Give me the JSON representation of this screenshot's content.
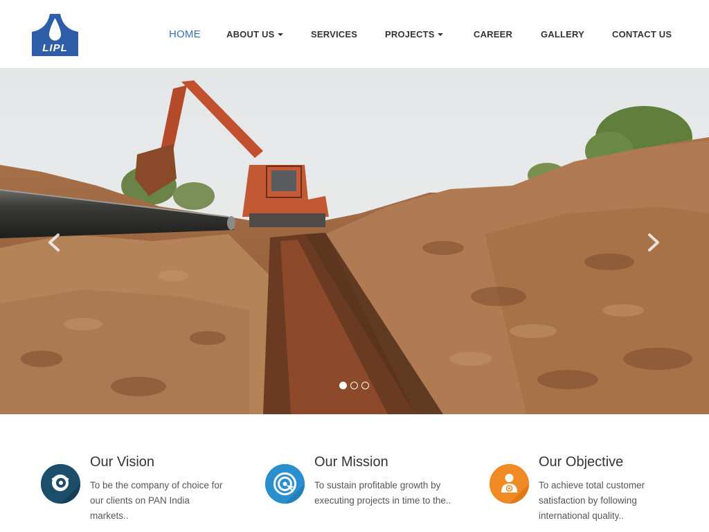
{
  "brand": {
    "logo_text": "LIPL",
    "logo_color": "#2f5ea8"
  },
  "nav": {
    "items": [
      {
        "label": "HOME",
        "active": true
      },
      {
        "label": "ABOUT US",
        "dropdown": true
      },
      {
        "label": "SERVICES"
      },
      {
        "label": "PROJECTS",
        "dropdown": true
      },
      {
        "label": "CAREER"
      },
      {
        "label": "GALLERY"
      },
      {
        "label": "CONTACT US"
      }
    ],
    "active_color": "#3a6db5"
  },
  "slider": {
    "prev_icon": "chevron-left-icon",
    "next_icon": "chevron-right-icon",
    "slide_count": 3,
    "active_index": 0
  },
  "features": [
    {
      "title": "Our Vision",
      "text": "To be the company of choice for our clients on PAN India markets..",
      "icon": "vision-eye-icon",
      "color": "#1c4e6b"
    },
    {
      "title": "Our Mission",
      "text": "To sustain profitable growth by executing projects in time to the..",
      "icon": "target-icon",
      "color": "#2a8fcf"
    },
    {
      "title": "Our Objective",
      "text": "To achieve total customer satisfaction by following international quality..",
      "icon": "person-target-icon",
      "color": "#f08a24"
    }
  ]
}
